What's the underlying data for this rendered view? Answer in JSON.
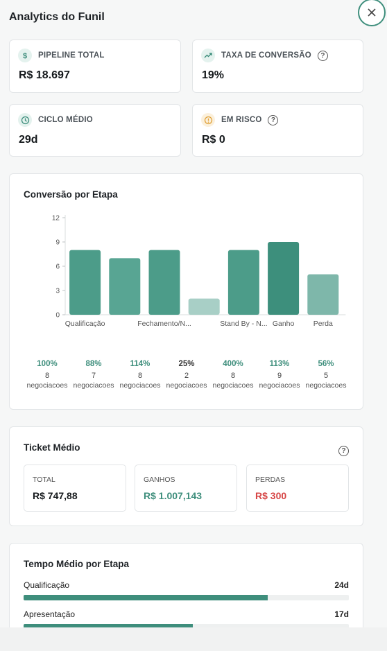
{
  "panel": {
    "title": "Analytics do Funil"
  },
  "kpis": [
    {
      "label": "PIPELINE TOTAL",
      "value": "R$ 18.697",
      "icon": "dollar-icon",
      "help": false
    },
    {
      "label": "TAXA DE CONVERSÃO",
      "value": "19%",
      "icon": "trend-up-icon",
      "help": true
    },
    {
      "label": "CICLO MÉDIO",
      "value": "29d",
      "icon": "clock-icon",
      "help": false
    },
    {
      "label": "EM RISCO",
      "value": "R$ 0",
      "icon": "alert-icon",
      "help": true
    }
  ],
  "conversion": {
    "title": "Conversão por Etapa",
    "ticks": [
      "12",
      "9",
      "6",
      "3",
      "0"
    ],
    "axis_labels": [
      "Qualificação",
      "",
      "Fechamento/N...",
      "",
      "Stand By - N...",
      "Ganho",
      "Perda"
    ],
    "stats": [
      {
        "pct": "100%",
        "count": "8",
        "unit": "negociacoes"
      },
      {
        "pct": "88%",
        "count": "7",
        "unit": "negociacoes"
      },
      {
        "pct": "114%",
        "count": "8",
        "unit": "negociacoes"
      },
      {
        "pct": "25%",
        "count": "2",
        "unit": "negociacoes"
      },
      {
        "pct": "400%",
        "count": "8",
        "unit": "negociacoes"
      },
      {
        "pct": "113%",
        "count": "9",
        "unit": "negociacoes"
      },
      {
        "pct": "56%",
        "count": "5",
        "unit": "negociacoes"
      }
    ]
  },
  "chart_data": {
    "type": "bar",
    "categories": [
      "Qualificação",
      "",
      "Fechamento/N...",
      "",
      "Stand By - N...",
      "Ganho",
      "Perda"
    ],
    "values": [
      8,
      7,
      8,
      2,
      8,
      9,
      5
    ],
    "ylim": [
      0,
      12
    ],
    "yticks": [
      0,
      3,
      6,
      9,
      12
    ],
    "colors": [
      "#4c9c89",
      "#58a593",
      "#4c9c89",
      "#a8cfc6",
      "#4c9c89",
      "#3d8f7c",
      "#7eb7aa"
    ],
    "grid": false
  },
  "ticket": {
    "title": "Ticket Médio",
    "boxes": [
      {
        "label": "TOTAL",
        "value": "R$ 747,88",
        "color": "#15191c"
      },
      {
        "label": "GANHOS",
        "value": "R$ 1.007,143",
        "color": "#3e8e7c"
      },
      {
        "label": "PERDAS",
        "value": "R$ 300",
        "color": "#d64545"
      }
    ]
  },
  "stage_time": {
    "title": "Tempo Médio por Etapa",
    "rows": [
      {
        "name": "Qualificação",
        "days": "24d",
        "fraction": 0.75
      },
      {
        "name": "Apresentação",
        "days": "17d",
        "fraction": 0.52
      }
    ]
  },
  "colors": {
    "accent": "#3e8e7c",
    "danger": "#d64545",
    "warning": "#e0a23a"
  }
}
